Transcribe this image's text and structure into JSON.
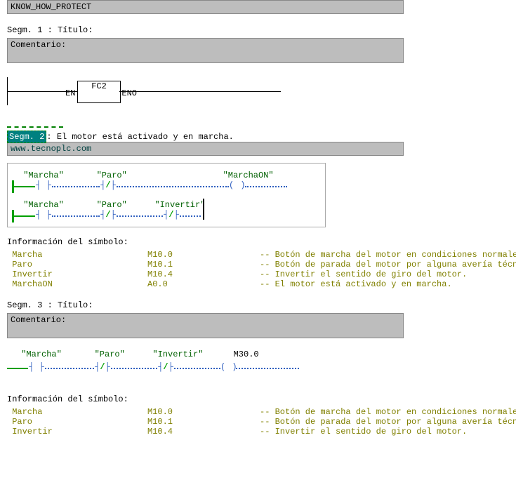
{
  "header_protect": "KNOW_HOW_PROTECT",
  "seg1": {
    "title": "Segm. 1 : Título:",
    "comment": "Comentario:"
  },
  "fc": {
    "name": "FC2",
    "en": "EN",
    "eno": "ENO"
  },
  "seg2": {
    "label": "Segm. 2",
    "title": ": El motor está activado y en marcha.",
    "url": "www.tecnoplc.com"
  },
  "rung1": {
    "c1": "\"Marcha\"",
    "c2": "\"Paro\"",
    "out": "\"MarchaON\""
  },
  "rung2": {
    "c1": "\"Marcha\"",
    "c2": "\"Paro\"",
    "c3": "\"Invertir\""
  },
  "syminfo_label": "Información del símbolo:",
  "symtable1": [
    {
      "sym": " Marcha",
      "addr": "M10.0",
      "desc": "-- Botón de marcha del motor en condiciones normales"
    },
    {
      "sym": " Paro",
      "addr": "M10.1",
      "desc": "-- Botón de parada del motor por alguna avería técnica."
    },
    {
      "sym": " Invertir",
      "addr": "M10.4",
      "desc": "-- Invertir el sentido de giro del motor."
    },
    {
      "sym": " MarchaON",
      "addr": "A0.0",
      "desc": "-- El motor está activado y en marcha."
    }
  ],
  "seg3": {
    "title": "Segm. 3 : Título:",
    "comment": "Comentario:"
  },
  "rung3": {
    "c1": "\"Marcha\"",
    "c2": "\"Paro\"",
    "c3": "\"Invertir\"",
    "out": "M30.0"
  },
  "symtable2": [
    {
      "sym": " Marcha",
      "addr": "M10.0",
      "desc": "-- Botón de marcha del motor en condiciones normales"
    },
    {
      "sym": " Paro",
      "addr": "M10.1",
      "desc": "-- Botón de parada del motor por alguna avería técnica."
    },
    {
      "sym": " Invertir",
      "addr": "M10.4",
      "desc": "-- Invertir el sentido de giro del motor."
    }
  ]
}
